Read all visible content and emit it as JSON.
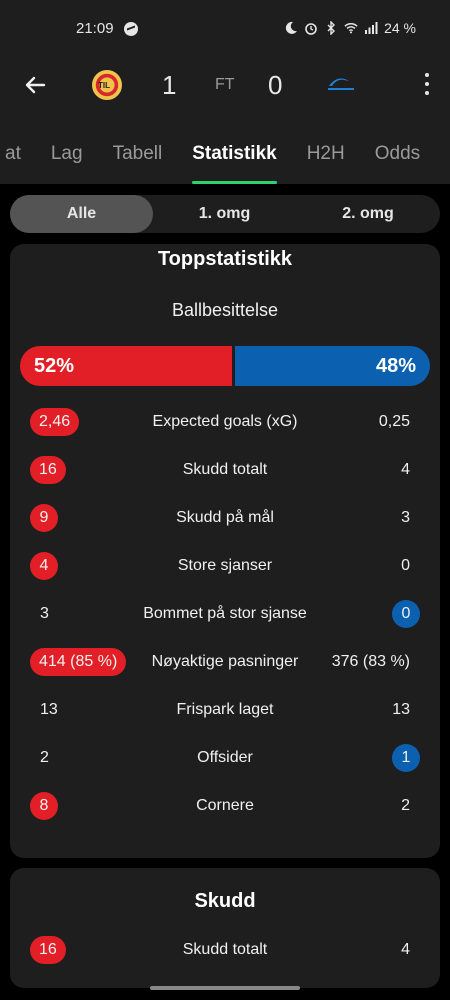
{
  "status_bar": {
    "time": "21:09",
    "battery": "24 %",
    "icons": [
      "messenger-icon",
      "moon-icon",
      "alarm-icon",
      "bluetooth-icon",
      "wifi-icon",
      "signal-icon"
    ]
  },
  "header": {
    "home_score": "1",
    "away_score": "0",
    "match_status": "FT",
    "home_logo_text": "TIL"
  },
  "tabs": [
    {
      "label": "at"
    },
    {
      "label": "Lag"
    },
    {
      "label": "Tabell"
    },
    {
      "label": "Statistikk"
    },
    {
      "label": "H2H"
    },
    {
      "label": "Odds"
    }
  ],
  "active_tab": "Statistikk",
  "period_filter": {
    "options": [
      "Alle",
      "1. omg",
      "2. omg"
    ],
    "selected": "Alle"
  },
  "top_stats": {
    "title": "Toppstatistikk",
    "possession": {
      "label": "Ballbesittelse",
      "home": "52%",
      "away": "48%",
      "home_fraction": 0.52
    },
    "rows": [
      {
        "label": "Expected goals (xG)",
        "home": "2,46",
        "away": "0,25",
        "highlight": "home"
      },
      {
        "label": "Skudd totalt",
        "home": "16",
        "away": "4",
        "highlight": "home"
      },
      {
        "label": "Skudd på mål",
        "home": "9",
        "away": "3",
        "highlight": "home"
      },
      {
        "label": "Store sjanser",
        "home": "4",
        "away": "0",
        "highlight": "home"
      },
      {
        "label": "Bommet på stor sjanse",
        "home": "3",
        "away": "0",
        "highlight": "away"
      },
      {
        "label": "Nøyaktige pasninger",
        "home": "414 (85 %)",
        "away": "376 (83 %)",
        "highlight": "home"
      },
      {
        "label": "Frispark laget",
        "home": "13",
        "away": "13",
        "highlight": "none"
      },
      {
        "label": "Offsider",
        "home": "2",
        "away": "1",
        "highlight": "away"
      },
      {
        "label": "Cornere",
        "home": "8",
        "away": "2",
        "highlight": "home"
      }
    ]
  },
  "shots": {
    "title": "Skudd",
    "rows": [
      {
        "label": "Skudd totalt",
        "home": "16",
        "away": "4",
        "highlight": "home"
      }
    ]
  },
  "colors": {
    "home": "#e21f26",
    "away": "#0b61b0",
    "tab_indicator": "#2fd270",
    "background": "#000000",
    "card": "#1e1e1e"
  }
}
